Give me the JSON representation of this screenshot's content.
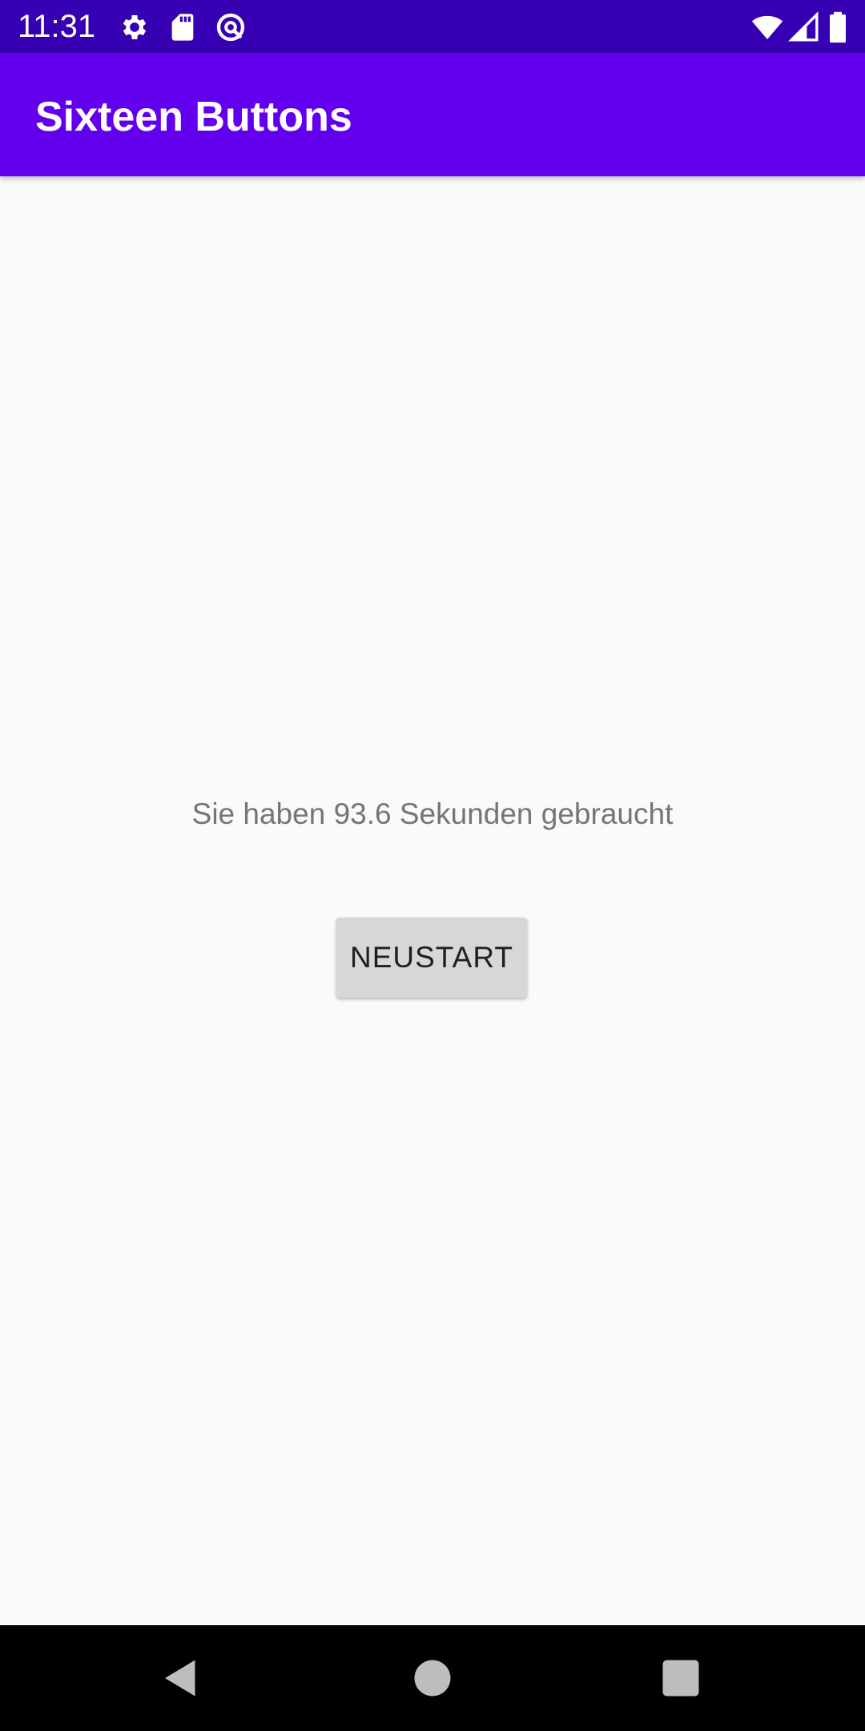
{
  "status_bar": {
    "time": "11:31",
    "icons": [
      "gear-icon",
      "sd-card-icon",
      "vpn-key-icon",
      "wifi-icon",
      "signal-icon",
      "battery-icon"
    ],
    "background": "#3700b3"
  },
  "app_bar": {
    "title": "Sixteen Buttons",
    "background": "#6200ee"
  },
  "main": {
    "result_text": "Sie haben 93.6 Sekunden gebraucht",
    "restart_label": "NEUSTART"
  },
  "nav_bar": {
    "buttons": [
      "back-icon",
      "home-icon",
      "recents-icon"
    ]
  }
}
